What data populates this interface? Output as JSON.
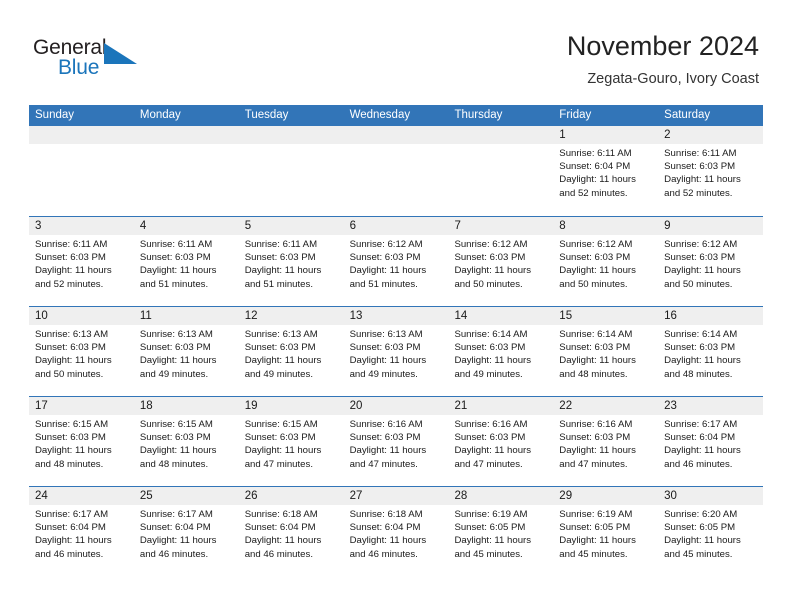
{
  "brand": {
    "word_one": "General",
    "word_two": "Blue",
    "mark_name": "triangle-flag-mark",
    "color_text": "#231f20",
    "color_blue": "#1b75bb"
  },
  "header": {
    "title": "November 2024",
    "subtitle": "Zegata-Gouro, Ivory Coast"
  },
  "theme": {
    "header_blue": "#3275b8",
    "daynum_band": "#efefef",
    "text": "#1a1a1a",
    "page_bg": "#ffffff"
  },
  "weekdays": [
    "Sunday",
    "Monday",
    "Tuesday",
    "Wednesday",
    "Thursday",
    "Friday",
    "Saturday"
  ],
  "weeks": [
    [
      {
        "day": "",
        "info": ""
      },
      {
        "day": "",
        "info": ""
      },
      {
        "day": "",
        "info": ""
      },
      {
        "day": "",
        "info": ""
      },
      {
        "day": "",
        "info": ""
      },
      {
        "day": "1",
        "info": "Sunrise: 6:11 AM\nSunset: 6:04 PM\nDaylight: 11 hours\nand 52 minutes."
      },
      {
        "day": "2",
        "info": "Sunrise: 6:11 AM\nSunset: 6:03 PM\nDaylight: 11 hours\nand 52 minutes."
      }
    ],
    [
      {
        "day": "3",
        "info": "Sunrise: 6:11 AM\nSunset: 6:03 PM\nDaylight: 11 hours\nand 52 minutes."
      },
      {
        "day": "4",
        "info": "Sunrise: 6:11 AM\nSunset: 6:03 PM\nDaylight: 11 hours\nand 51 minutes."
      },
      {
        "day": "5",
        "info": "Sunrise: 6:11 AM\nSunset: 6:03 PM\nDaylight: 11 hours\nand 51 minutes."
      },
      {
        "day": "6",
        "info": "Sunrise: 6:12 AM\nSunset: 6:03 PM\nDaylight: 11 hours\nand 51 minutes."
      },
      {
        "day": "7",
        "info": "Sunrise: 6:12 AM\nSunset: 6:03 PM\nDaylight: 11 hours\nand 50 minutes."
      },
      {
        "day": "8",
        "info": "Sunrise: 6:12 AM\nSunset: 6:03 PM\nDaylight: 11 hours\nand 50 minutes."
      },
      {
        "day": "9",
        "info": "Sunrise: 6:12 AM\nSunset: 6:03 PM\nDaylight: 11 hours\nand 50 minutes."
      }
    ],
    [
      {
        "day": "10",
        "info": "Sunrise: 6:13 AM\nSunset: 6:03 PM\nDaylight: 11 hours\nand 50 minutes."
      },
      {
        "day": "11",
        "info": "Sunrise: 6:13 AM\nSunset: 6:03 PM\nDaylight: 11 hours\nand 49 minutes."
      },
      {
        "day": "12",
        "info": "Sunrise: 6:13 AM\nSunset: 6:03 PM\nDaylight: 11 hours\nand 49 minutes."
      },
      {
        "day": "13",
        "info": "Sunrise: 6:13 AM\nSunset: 6:03 PM\nDaylight: 11 hours\nand 49 minutes."
      },
      {
        "day": "14",
        "info": "Sunrise: 6:14 AM\nSunset: 6:03 PM\nDaylight: 11 hours\nand 49 minutes."
      },
      {
        "day": "15",
        "info": "Sunrise: 6:14 AM\nSunset: 6:03 PM\nDaylight: 11 hours\nand 48 minutes."
      },
      {
        "day": "16",
        "info": "Sunrise: 6:14 AM\nSunset: 6:03 PM\nDaylight: 11 hours\nand 48 minutes."
      }
    ],
    [
      {
        "day": "17",
        "info": "Sunrise: 6:15 AM\nSunset: 6:03 PM\nDaylight: 11 hours\nand 48 minutes."
      },
      {
        "day": "18",
        "info": "Sunrise: 6:15 AM\nSunset: 6:03 PM\nDaylight: 11 hours\nand 48 minutes."
      },
      {
        "day": "19",
        "info": "Sunrise: 6:15 AM\nSunset: 6:03 PM\nDaylight: 11 hours\nand 47 minutes."
      },
      {
        "day": "20",
        "info": "Sunrise: 6:16 AM\nSunset: 6:03 PM\nDaylight: 11 hours\nand 47 minutes."
      },
      {
        "day": "21",
        "info": "Sunrise: 6:16 AM\nSunset: 6:03 PM\nDaylight: 11 hours\nand 47 minutes."
      },
      {
        "day": "22",
        "info": "Sunrise: 6:16 AM\nSunset: 6:03 PM\nDaylight: 11 hours\nand 47 minutes."
      },
      {
        "day": "23",
        "info": "Sunrise: 6:17 AM\nSunset: 6:04 PM\nDaylight: 11 hours\nand 46 minutes."
      }
    ],
    [
      {
        "day": "24",
        "info": "Sunrise: 6:17 AM\nSunset: 6:04 PM\nDaylight: 11 hours\nand 46 minutes."
      },
      {
        "day": "25",
        "info": "Sunrise: 6:17 AM\nSunset: 6:04 PM\nDaylight: 11 hours\nand 46 minutes."
      },
      {
        "day": "26",
        "info": "Sunrise: 6:18 AM\nSunset: 6:04 PM\nDaylight: 11 hours\nand 46 minutes."
      },
      {
        "day": "27",
        "info": "Sunrise: 6:18 AM\nSunset: 6:04 PM\nDaylight: 11 hours\nand 46 minutes."
      },
      {
        "day": "28",
        "info": "Sunrise: 6:19 AM\nSunset: 6:05 PM\nDaylight: 11 hours\nand 45 minutes."
      },
      {
        "day": "29",
        "info": "Sunrise: 6:19 AM\nSunset: 6:05 PM\nDaylight: 11 hours\nand 45 minutes."
      },
      {
        "day": "30",
        "info": "Sunrise: 6:20 AM\nSunset: 6:05 PM\nDaylight: 11 hours\nand 45 minutes."
      }
    ]
  ]
}
